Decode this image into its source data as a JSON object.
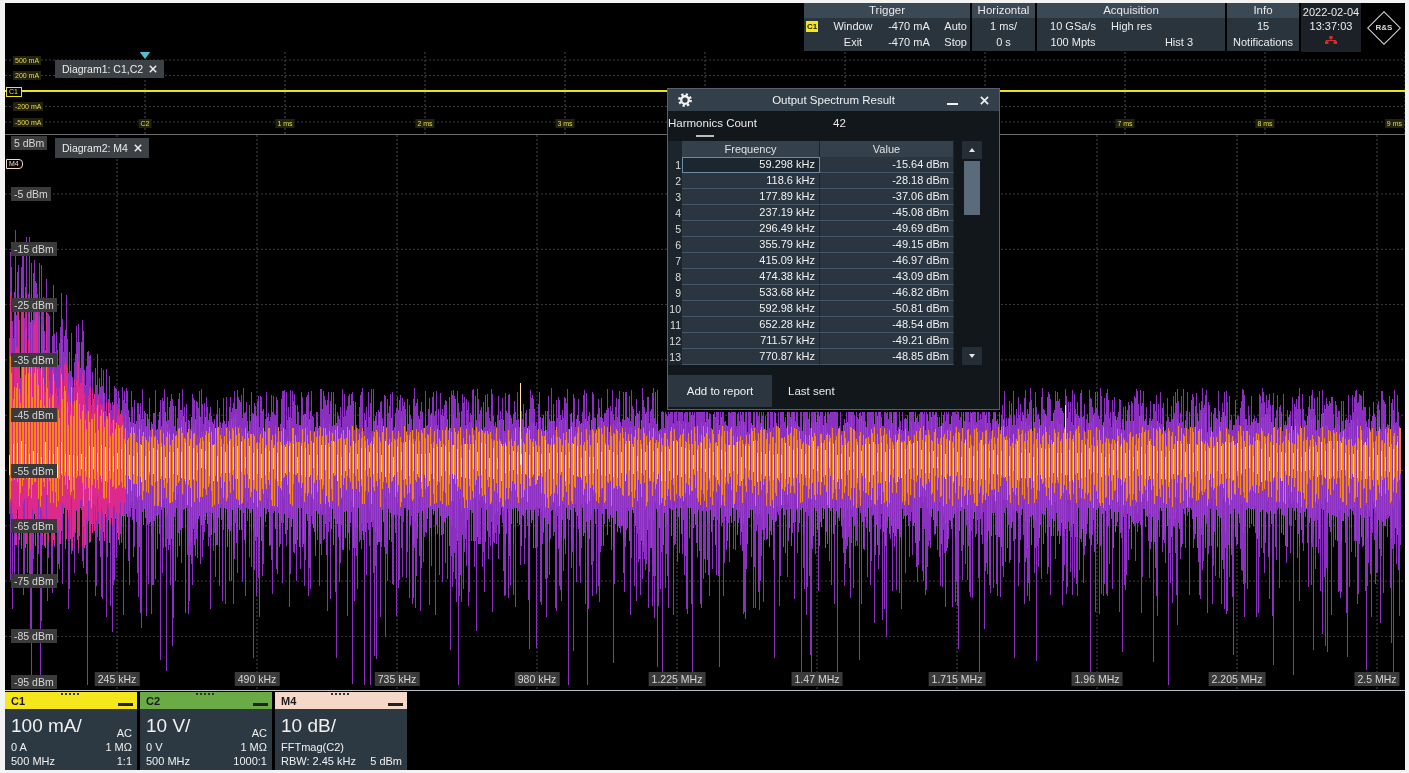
{
  "top_bar": {
    "trigger": {
      "title": "Trigger",
      "source": "C1",
      "rows": [
        {
          "mode": "Window",
          "level": "-470 mA",
          "state": "Auto"
        },
        {
          "mode": "Exit",
          "level": "-470 mA",
          "state": "Stop"
        }
      ]
    },
    "horizontal": {
      "title": "Horizontal",
      "scale": "1 ms/",
      "position": "0 s"
    },
    "acquisition": {
      "title": "Acquisition",
      "sample_rate": "10 GSa/s",
      "mode": "High res",
      "record_length": "100 Mpts",
      "history": "Hist 3"
    },
    "info": {
      "title": "Info",
      "count": "15",
      "label": "Notifications"
    },
    "clock": {
      "date": "2022-02-04",
      "time": "13:37:03"
    },
    "logo": "R&S"
  },
  "diagram1": {
    "tab": "Diagram1: C1,C2",
    "marker": "C1",
    "y_labels": [
      "500 mA",
      "200 mA",
      "-200 mA",
      "-500 mA"
    ],
    "x_labels": [
      "C2",
      "1 ms",
      "2 ms",
      "3 ms"
    ],
    "x_labels_end": [
      "7 ms",
      "8 ms",
      "9 ms"
    ]
  },
  "diagram2": {
    "tab": "Diagram2: M4",
    "marker": "M4",
    "y_labels": [
      "5 dBm",
      "-5 dBm",
      "-15 dBm",
      "-25 dBm",
      "-35 dBm",
      "-45 dBm",
      "-55 dBm",
      "-65 dBm",
      "-75 dBm",
      "-85 dBm",
      "-95 dBm"
    ],
    "x_labels": [
      "245 kHz",
      "490 kHz",
      "735 kHz",
      "980 kHz",
      "1.225 MHz",
      "1.47 MHz",
      "1.715 MHz",
      "1.96 MHz",
      "2.205 MHz",
      "2.5 MHz"
    ]
  },
  "dialog": {
    "title": "Output Spectrum Result",
    "harmonics_label": "Harmonics Count",
    "harmonics_value": "42",
    "columns": [
      "Frequency",
      "Value"
    ],
    "rows": [
      {
        "index": "1",
        "frequency": "59.298 kHz",
        "value": "-15.64 dBm",
        "selected": true
      },
      {
        "index": "2",
        "frequency": "118.6 kHz",
        "value": "-28.18 dBm",
        "selected": false
      },
      {
        "index": "3",
        "frequency": "177.89 kHz",
        "value": "-37.06 dBm",
        "selected": false
      },
      {
        "index": "4",
        "frequency": "237.19 kHz",
        "value": "-45.08 dBm",
        "selected": false
      },
      {
        "index": "5",
        "frequency": "296.49 kHz",
        "value": "-49.69 dBm",
        "selected": false
      },
      {
        "index": "6",
        "frequency": "355.79 kHz",
        "value": "-49.15 dBm",
        "selected": false
      },
      {
        "index": "7",
        "frequency": "415.09 kHz",
        "value": "-46.97 dBm",
        "selected": false
      },
      {
        "index": "8",
        "frequency": "474.38 kHz",
        "value": "-43.09 dBm",
        "selected": false
      },
      {
        "index": "9",
        "frequency": "533.68 kHz",
        "value": "-46.82 dBm",
        "selected": false
      },
      {
        "index": "10",
        "frequency": "592.98 kHz",
        "value": "-50.81 dBm",
        "selected": false
      },
      {
        "index": "11",
        "frequency": "652.28 kHz",
        "value": "-48.54 dBm",
        "selected": false
      },
      {
        "index": "12",
        "frequency": "711.57 kHz",
        "value": "-49.21 dBm",
        "selected": false
      },
      {
        "index": "13",
        "frequency": "770.87 kHz",
        "value": "-48.85 dBm",
        "selected": false
      }
    ],
    "button": "Add to report",
    "status": "Last sent"
  },
  "channels": [
    {
      "kind": "channel",
      "name": "C1",
      "color": "#f6e61c",
      "scale": "100 mA/",
      "coupling": "AC",
      "offset": "0 A",
      "impedance": "1 MΩ",
      "bandwidth": "500 MHz",
      "ratio": "1:1"
    },
    {
      "kind": "channel",
      "name": "C2",
      "color": "#6aab46",
      "scale": "10 V/",
      "coupling": "AC",
      "offset": "0 V",
      "impedance": "1 MΩ",
      "bandwidth": "500 MHz",
      "ratio": "1000:1"
    },
    {
      "kind": "math",
      "name": "M4",
      "color": "#f6d8c8",
      "scale": "10 dB/",
      "source": "FFTmag(C2)",
      "rbw": "RBW: 2.45 kHz",
      "reference": "5 dBm"
    }
  ]
}
